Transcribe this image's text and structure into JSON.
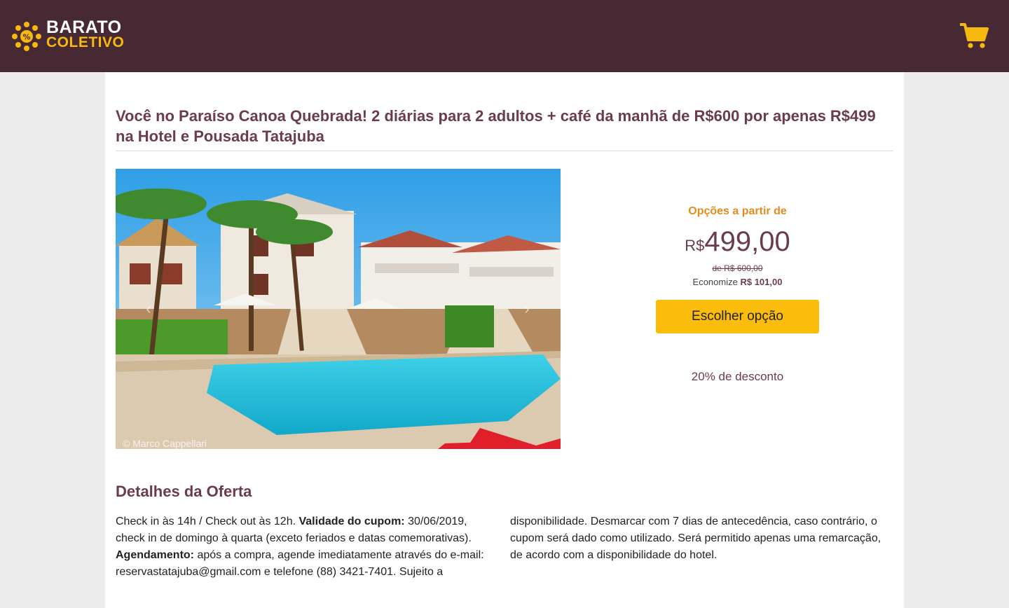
{
  "brand": {
    "line1": "BARATO",
    "line2": "COLETIVO",
    "colors": {
      "header_bg": "#472933",
      "accent": "#f8b90f",
      "title": "#6b3d4c",
      "orange": "#e28c1d"
    }
  },
  "header": {
    "cart_icon": "shopping-cart-icon"
  },
  "deal": {
    "title": "Você no Paraíso Canoa Quebrada! 2 diárias para 2 adultos + café da manhã de R$600 por apenas R$499 na Hotel e Pousada Tatajuba",
    "photo_credit": "© Marco Cappellari",
    "from_label": "Opções a partir de",
    "currency": "R$",
    "price": "499,00",
    "old_price": "de R$ 600,00",
    "savings_label": "Economize",
    "savings_value": "R$ 101,00",
    "choose_button": "Escolher opção",
    "discount": "20% de desconto"
  },
  "details": {
    "title": "Detalhes da Oferta",
    "col1": {
      "t1": "Check in às 14h / Check out às 12h. ",
      "b1": "Validade do cupom:",
      "t2": " 30/06/2019, check in de domingo à quarta (exceto feriados e datas comemorativas). ",
      "b2": "Agendamento:",
      "t3": " após a compra, agende imediatamente através do e-mail: reservastatajuba@gmail.com e telefone (88) 3421-7401. Sujeito a"
    },
    "col2": "disponibilidade. Desmarcar com 7 dias de antecedência, caso contrário, o cupom será dado como utilizado. Será permitido apenas uma remarcação, de acordo com a disponibilidade do hotel."
  }
}
